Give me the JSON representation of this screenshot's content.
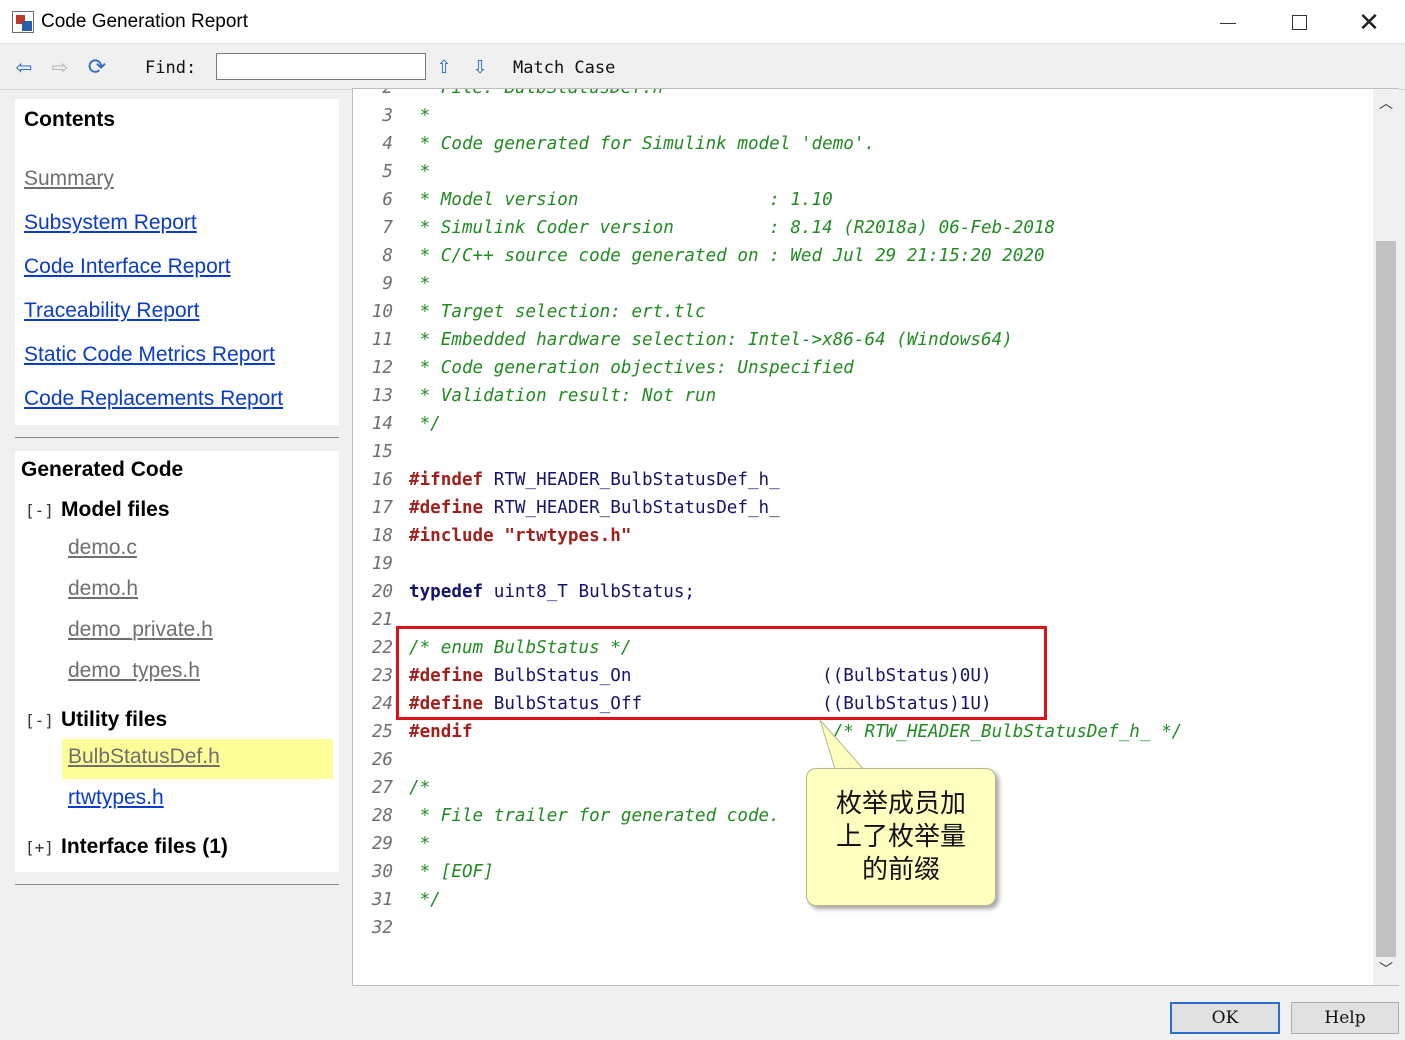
{
  "window": {
    "title": "Code Generation Report"
  },
  "toolbar": {
    "find_label": "Find:",
    "find_value": "",
    "match_case_label": "Match Case"
  },
  "sidebar": {
    "contents_title": "Contents",
    "links": [
      {
        "label": "Summary",
        "visited": true
      },
      {
        "label": "Subsystem Report",
        "visited": false
      },
      {
        "label": "Code Interface Report",
        "visited": false
      },
      {
        "label": "Traceability Report",
        "visited": false
      },
      {
        "label": "Static Code Metrics Report",
        "visited": false
      },
      {
        "label": "Code Replacements Report",
        "visited": false
      }
    ],
    "generated_title": "Generated Code",
    "groups": [
      {
        "toggle": "[-]",
        "title": "Model files",
        "files": [
          "demo.c",
          "demo.h",
          "demo_private.h",
          "demo_types.h"
        ]
      },
      {
        "toggle": "[-]",
        "title": "Utility files",
        "files": [
          "BulbStatusDef.h",
          "rtwtypes.h"
        ],
        "selected": "BulbStatusDef.h"
      },
      {
        "toggle": "[+]",
        "title": "Interface files (1)",
        "files": []
      }
    ]
  },
  "code": {
    "lines": [
      {
        "n": "2",
        "tokens": [
          [
            "comment",
            " * File: BulbStatusDef.h"
          ]
        ]
      },
      {
        "n": "3",
        "tokens": [
          [
            "comment",
            " *"
          ]
        ]
      },
      {
        "n": "4",
        "tokens": [
          [
            "comment",
            " * Code generated for Simulink model 'demo'."
          ]
        ]
      },
      {
        "n": "5",
        "tokens": [
          [
            "comment",
            " *"
          ]
        ]
      },
      {
        "n": "6",
        "tokens": [
          [
            "comment",
            " * Model version                  : 1.10"
          ]
        ]
      },
      {
        "n": "7",
        "tokens": [
          [
            "comment",
            " * Simulink Coder version         : 8.14 (R2018a) 06-Feb-2018"
          ]
        ]
      },
      {
        "n": "8",
        "tokens": [
          [
            "comment",
            " * C/C++ source code generated on : Wed Jul 29 21:15:20 2020"
          ]
        ]
      },
      {
        "n": "9",
        "tokens": [
          [
            "comment",
            " *"
          ]
        ]
      },
      {
        "n": "10",
        "tokens": [
          [
            "comment",
            " * Target selection: ert.tlc"
          ]
        ]
      },
      {
        "n": "11",
        "tokens": [
          [
            "comment",
            " * Embedded hardware selection: Intel->x86-64 (Windows64)"
          ]
        ]
      },
      {
        "n": "12",
        "tokens": [
          [
            "comment",
            " * Code generation objectives: Unspecified"
          ]
        ]
      },
      {
        "n": "13",
        "tokens": [
          [
            "comment",
            " * Validation result: Not run"
          ]
        ]
      },
      {
        "n": "14",
        "tokens": [
          [
            "comment",
            " */"
          ]
        ]
      },
      {
        "n": "15",
        "tokens": []
      },
      {
        "n": "16",
        "tokens": [
          [
            "pp",
            "#ifndef"
          ],
          [
            "id",
            " RTW_HEADER_BulbStatusDef_h_"
          ]
        ]
      },
      {
        "n": "17",
        "tokens": [
          [
            "pp",
            "#define"
          ],
          [
            "id",
            " RTW_HEADER_BulbStatusDef_h_"
          ]
        ]
      },
      {
        "n": "18",
        "tokens": [
          [
            "pp",
            "#include"
          ],
          [
            "id",
            " "
          ],
          [
            "str",
            "\"rtwtypes.h\""
          ]
        ]
      },
      {
        "n": "19",
        "tokens": []
      },
      {
        "n": "20",
        "tokens": [
          [
            "kw",
            "typedef"
          ],
          [
            "id",
            " uint8_T BulbStatus;"
          ]
        ]
      },
      {
        "n": "21",
        "tokens": []
      },
      {
        "n": "22",
        "tokens": [
          [
            "comment",
            "/* enum BulbStatus */"
          ]
        ]
      },
      {
        "n": "23",
        "tokens": [
          [
            "pp",
            "#define"
          ],
          [
            "id",
            " BulbStatus_On                  ((BulbStatus)0U)"
          ]
        ]
      },
      {
        "n": "24",
        "tokens": [
          [
            "pp",
            "#define"
          ],
          [
            "id",
            " BulbStatus_Off                 ((BulbStatus)1U)"
          ]
        ]
      },
      {
        "n": "25",
        "tokens": [
          [
            "pp",
            "#endif"
          ],
          [
            "id",
            "                                  "
          ],
          [
            "comment",
            "/* RTW_HEADER_BulbStatusDef_h_ */"
          ]
        ]
      },
      {
        "n": "26",
        "tokens": []
      },
      {
        "n": "27",
        "tokens": [
          [
            "comment",
            "/*"
          ]
        ]
      },
      {
        "n": "28",
        "tokens": [
          [
            "comment",
            " * File trailer for generated code."
          ]
        ]
      },
      {
        "n": "29",
        "tokens": [
          [
            "comment",
            " *"
          ]
        ]
      },
      {
        "n": "30",
        "tokens": [
          [
            "comment",
            " * [EOF]"
          ]
        ]
      },
      {
        "n": "31",
        "tokens": [
          [
            "comment",
            " */"
          ]
        ]
      },
      {
        "n": "32",
        "tokens": []
      }
    ]
  },
  "annotation": {
    "callout_text": [
      "枚举成员加",
      "上了枚举量",
      "的前缀"
    ],
    "box_color": "#e0101a",
    "callout_bg": "#ffffc0"
  },
  "buttons": {
    "ok_label": "OK",
    "help_label": "Help"
  },
  "colors": {
    "link": "#0a3cc8",
    "visited_link": "#6f6f6f",
    "comment": "#228b22",
    "preprocessor": "#a0201c",
    "selected_file_bg": "#ffff9a"
  }
}
